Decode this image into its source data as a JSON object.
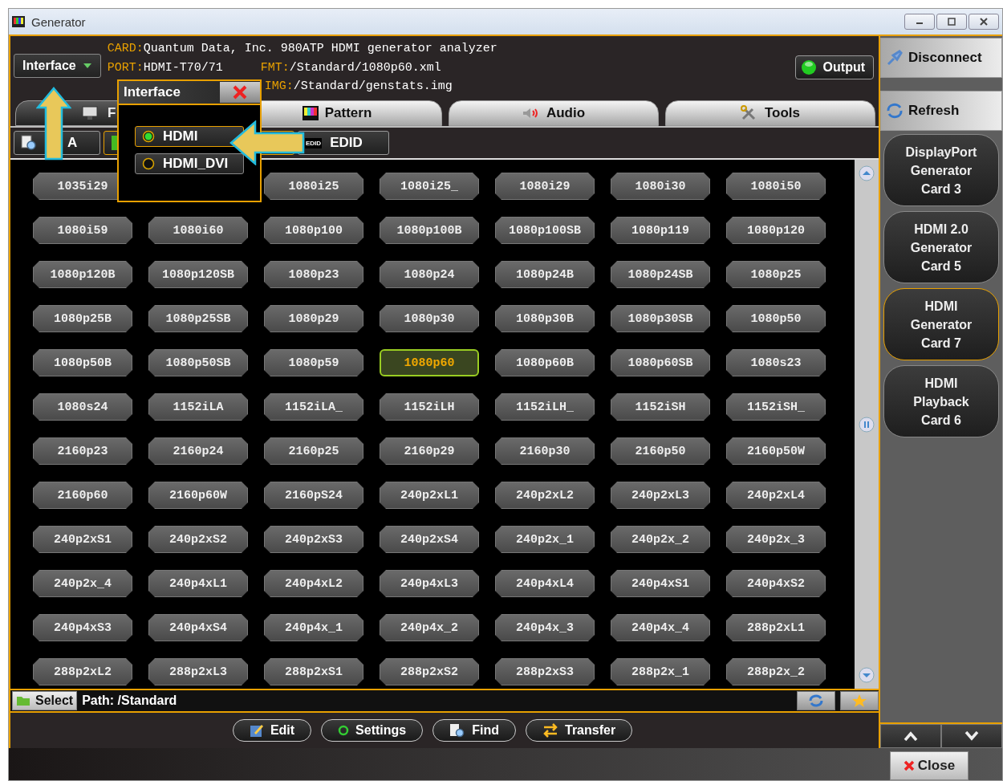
{
  "window": {
    "title": "Generator"
  },
  "header": {
    "interface_button": "Interface",
    "card": {
      "label": "CARD:",
      "value": "Quantum Data, Inc. 980ATP HDMI generator analyzer"
    },
    "port": {
      "label": "PORT:",
      "value": "HDMI-T70/71"
    },
    "fmt": {
      "label": "FMT:",
      "value": "/Standard/1080p60.xml"
    },
    "img": {
      "label": "IMG:",
      "value": "/Standard/genstats.img"
    },
    "output": {
      "label": "Output",
      "on": true
    }
  },
  "tabs": [
    {
      "label": "F",
      "selected": true,
      "kind": "monitor"
    },
    {
      "label": "Pattern",
      "selected": false,
      "kind": "pattern"
    },
    {
      "label": "Audio",
      "selected": false,
      "kind": "speaker"
    },
    {
      "label": "Tools",
      "selected": false,
      "kind": "tools"
    }
  ],
  "subtabs": [
    {
      "label": "A",
      "selected": false,
      "kind": "magnifier"
    },
    {
      "selected": true,
      "kind": "green"
    },
    {
      "label": "EDID",
      "selected": false,
      "kind": "edid",
      "icon_text": "EDID"
    }
  ],
  "formats": [
    [
      {
        "label": "1035i29",
        "selected": false
      },
      {
        "label": "1080i25",
        "selected": false
      },
      {
        "label": "1080i25_",
        "selected": false
      },
      {
        "label": "1080i29",
        "selected": false
      },
      {
        "label": "1080i30",
        "selected": false
      },
      {
        "label": "1080i50",
        "selected": false
      }
    ],
    [
      {
        "label": "1080i59",
        "selected": false
      },
      {
        "label": "1080i60",
        "selected": false
      },
      {
        "label": "1080p100",
        "selected": false
      },
      {
        "label": "1080p100B",
        "selected": false
      },
      {
        "label": "1080p100SB",
        "selected": false
      },
      {
        "label": "1080p119",
        "selected": false
      },
      {
        "label": "1080p120",
        "selected": false
      }
    ],
    [
      {
        "label": "1080p120B",
        "selected": false
      },
      {
        "label": "1080p120SB",
        "selected": false
      },
      {
        "label": "1080p23",
        "selected": false
      },
      {
        "label": "1080p24",
        "selected": false
      },
      {
        "label": "1080p24B",
        "selected": false
      },
      {
        "label": "1080p24SB",
        "selected": false
      },
      {
        "label": "1080p25",
        "selected": false
      }
    ],
    [
      {
        "label": "1080p25B",
        "selected": false
      },
      {
        "label": "1080p25SB",
        "selected": false
      },
      {
        "label": "1080p29",
        "selected": false
      },
      {
        "label": "1080p30",
        "selected": false
      },
      {
        "label": "1080p30B",
        "selected": false
      },
      {
        "label": "1080p30SB",
        "selected": false
      },
      {
        "label": "1080p50",
        "selected": false
      }
    ],
    [
      {
        "label": "1080p50B",
        "selected": false
      },
      {
        "label": "1080p50SB",
        "selected": false
      },
      {
        "label": "1080p59",
        "selected": false
      },
      {
        "label": "1080p60",
        "selected": true
      },
      {
        "label": "1080p60B",
        "selected": false
      },
      {
        "label": "1080p60SB",
        "selected": false
      },
      {
        "label": "1080s23",
        "selected": false
      }
    ],
    [
      {
        "label": "1080s24",
        "selected": false
      },
      {
        "label": "1152iLA",
        "selected": false
      },
      {
        "label": "1152iLA_",
        "selected": false
      },
      {
        "label": "1152iLH",
        "selected": false
      },
      {
        "label": "1152iLH_",
        "selected": false
      },
      {
        "label": "1152iSH",
        "selected": false
      },
      {
        "label": "1152iSH_",
        "selected": false
      }
    ],
    [
      {
        "label": "2160p23",
        "selected": false
      },
      {
        "label": "2160p24",
        "selected": false
      },
      {
        "label": "2160p25",
        "selected": false
      },
      {
        "label": "2160p29",
        "selected": false
      },
      {
        "label": "2160p30",
        "selected": false
      },
      {
        "label": "2160p50",
        "selected": false
      },
      {
        "label": "2160p50W",
        "selected": false
      }
    ],
    [
      {
        "label": "2160p60",
        "selected": false
      },
      {
        "label": "2160p60W",
        "selected": false
      },
      {
        "label": "2160pS24",
        "selected": false
      },
      {
        "label": "240p2xL1",
        "selected": false
      },
      {
        "label": "240p2xL2",
        "selected": false
      },
      {
        "label": "240p2xL3",
        "selected": false
      },
      {
        "label": "240p2xL4",
        "selected": false
      }
    ],
    [
      {
        "label": "240p2xS1",
        "selected": false
      },
      {
        "label": "240p2xS2",
        "selected": false
      },
      {
        "label": "240p2xS3",
        "selected": false
      },
      {
        "label": "240p2xS4",
        "selected": false
      },
      {
        "label": "240p2x_1",
        "selected": false
      },
      {
        "label": "240p2x_2",
        "selected": false
      },
      {
        "label": "240p2x_3",
        "selected": false
      }
    ],
    [
      {
        "label": "240p2x_4",
        "selected": false
      },
      {
        "label": "240p4xL1",
        "selected": false
      },
      {
        "label": "240p4xL2",
        "selected": false
      },
      {
        "label": "240p4xL3",
        "selected": false
      },
      {
        "label": "240p4xL4",
        "selected": false
      },
      {
        "label": "240p4xS1",
        "selected": false
      },
      {
        "label": "240p4xS2",
        "selected": false
      }
    ],
    [
      {
        "label": "240p4xS3",
        "selected": false
      },
      {
        "label": "240p4xS4",
        "selected": false
      },
      {
        "label": "240p4x_1",
        "selected": false
      },
      {
        "label": "240p4x_2",
        "selected": false
      },
      {
        "label": "240p4x_3",
        "selected": false
      },
      {
        "label": "240p4x_4",
        "selected": false
      },
      {
        "label": "288p2xL1",
        "selected": false
      }
    ],
    [
      {
        "label": "288p2xL2",
        "selected": false
      },
      {
        "label": "288p2xL3",
        "selected": false
      },
      {
        "label": "288p2xS1",
        "selected": false
      },
      {
        "label": "288p2xS2",
        "selected": false
      },
      {
        "label": "288p2xS3",
        "selected": false
      },
      {
        "label": "288p2x_1",
        "selected": false
      },
      {
        "label": "288p2x_2",
        "selected": false
      }
    ]
  ],
  "popup": {
    "title": "Interface",
    "options": [
      {
        "label": "HDMI",
        "selected": true
      },
      {
        "label": "HDMI_DVI",
        "selected": false
      }
    ]
  },
  "status_bar": {
    "select_button": "Select",
    "path": "Path: /Standard"
  },
  "actions": [
    {
      "label": "Edit",
      "kind": "edit"
    },
    {
      "label": "Settings",
      "kind": "settings"
    },
    {
      "label": "Find",
      "kind": "find"
    },
    {
      "label": "Transfer",
      "kind": "transfer"
    }
  ],
  "sidebar": {
    "disconnect": "Disconnect",
    "refresh": "Refresh",
    "cards": [
      {
        "lines": [
          "DisplayPort",
          "Generator",
          "Card 3"
        ],
        "selected": false
      },
      {
        "lines": [
          "HDMI 2.0",
          "Generator",
          "Card 5"
        ],
        "selected": false
      },
      {
        "lines": [
          "HDMI",
          "Generator",
          "Card 7"
        ],
        "selected": true
      },
      {
        "lines": [
          "HDMI",
          "Playback",
          "Card 6"
        ],
        "selected": false
      }
    ],
    "close": "Close"
  }
}
